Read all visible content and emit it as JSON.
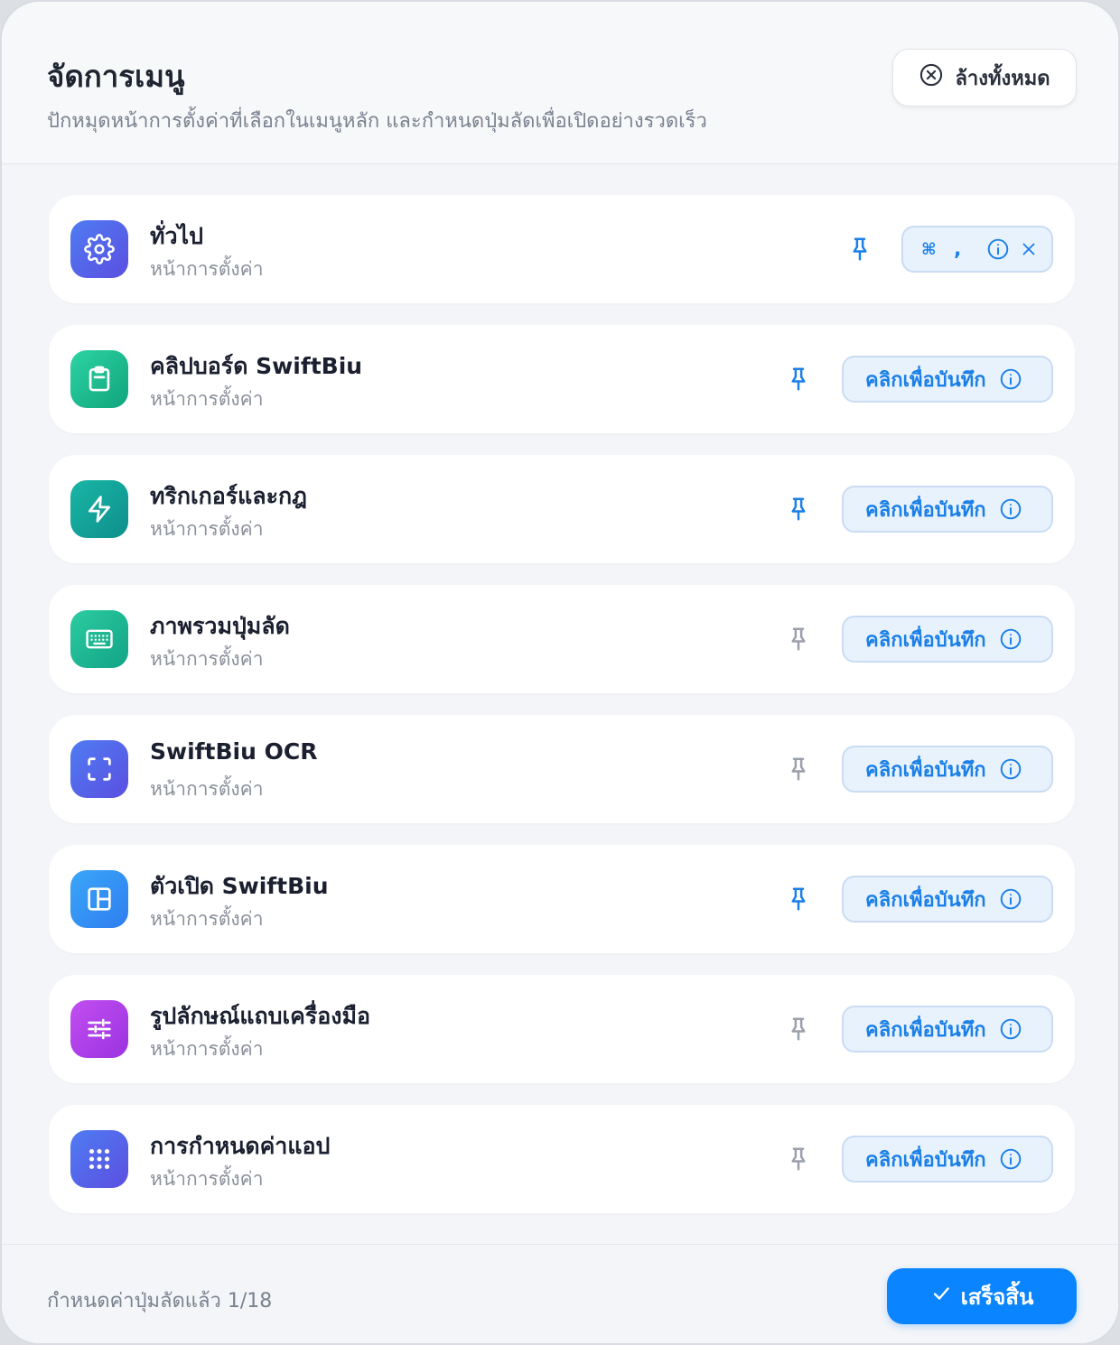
{
  "header": {
    "title": "จัดการเมนู",
    "subtitle": "ปักหมุดหน้าการตั้งค่าที่เลือกในเมนูหลัก และกำหนดปุ่มลัดเพื่อเปิดอย่างรวดเร็ว",
    "clear_all_label": "ล้างทั้งหมด"
  },
  "items": [
    {
      "title": "ทั่วไป",
      "subtitle": "หน้าการตั้งค่า",
      "icon": "gear-icon",
      "icon_gradient": [
        "#4f7cf3",
        "#5b4fe0"
      ],
      "pinned": true,
      "shortcut": {
        "key1": "⌘",
        "key2": ","
      }
    },
    {
      "title": "คลิปบอร์ด SwiftBiu",
      "subtitle": "หน้าการตั้งค่า",
      "icon": "clipboard-icon",
      "icon_gradient": [
        "#2dd4a4",
        "#10a47c"
      ],
      "pinned": true,
      "record_label": "คลิกเพื่อบันทึก"
    },
    {
      "title": "ทริกเกอร์และกฎ",
      "subtitle": "หน้าการตั้งค่า",
      "icon": "lightning-icon",
      "icon_gradient": [
        "#19b6a6",
        "#0e8f8c"
      ],
      "pinned": true,
      "record_label": "คลิกเพื่อบันทึก"
    },
    {
      "title": "ภาพรวมปุ่มลัด",
      "subtitle": "หน้าการตั้งค่า",
      "icon": "keyboard-icon",
      "icon_gradient": [
        "#2ccca0",
        "#12a386"
      ],
      "pinned": false,
      "record_label": "คลิกเพื่อบันทึก"
    },
    {
      "title": "SwiftBiu OCR",
      "subtitle": "หน้าการตั้งค่า",
      "icon": "scan-icon",
      "icon_gradient": [
        "#4f7cf3",
        "#5b4fe0"
      ],
      "pinned": false,
      "record_label": "คลิกเพื่อบันทึก"
    },
    {
      "title": "ตัวเปิด SwiftBiu",
      "subtitle": "หน้าการตั้งค่า",
      "icon": "layout-icon",
      "icon_gradient": [
        "#3aa6f8",
        "#2f7ef0"
      ],
      "pinned": true,
      "record_label": "คลิกเพื่อบันทึก"
    },
    {
      "title": "รูปลักษณ์แถบเครื่องมือ",
      "subtitle": "หน้าการตั้งค่า",
      "icon": "sliders-icon",
      "icon_gradient": [
        "#c24ef0",
        "#9b33e0"
      ],
      "pinned": false,
      "record_label": "คลิกเพื่อบันทึก"
    },
    {
      "title": "การกำหนดค่าแอป",
      "subtitle": "หน้าการตั้งค่า",
      "icon": "grid-icon",
      "icon_gradient": [
        "#4f7cf3",
        "#5b4fe0"
      ],
      "pinned": false,
      "record_label": "คลิกเพื่อบันทึก"
    }
  ],
  "footer": {
    "status": "กำหนดค่าปุ่มลัดแล้ว 1/18",
    "done_label": "เสร็จสิ้น"
  },
  "colors": {
    "accent": "#0a84ff",
    "pin_active": "#1a7fe6",
    "pin_inactive": "#9aa0aa"
  }
}
